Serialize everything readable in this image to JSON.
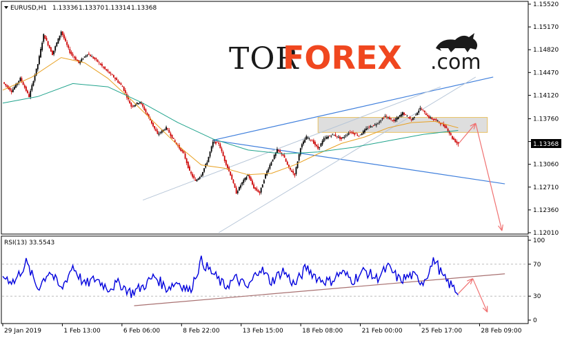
{
  "symbol_header": {
    "symbol": "EURUSD,H1",
    "open": "1.13336",
    "high": "1.13370",
    "low": "1.13314",
    "close": "1.13368"
  },
  "logo": {
    "part1": "TOR",
    "part2": "FOREX",
    "part3": ".com",
    "icon": "bull-icon"
  },
  "price_badge": "1.13368",
  "colors": {
    "candle_up": "#000000",
    "candle_down": "#cc0000",
    "ma_fast": "#e8a020",
    "ma_slow": "#1fa38c",
    "trend_blue": "#3f7fdc",
    "channel_grey": "#b7c6d8",
    "arrow": "#f07070",
    "zone_fill": "#d6d6d6",
    "zone_border": "#e8c060",
    "rsi_line": "#0000dd",
    "rsi_trend": "#a87070"
  },
  "chart_data": [
    {
      "type": "candlestick",
      "symbol": "EURUSD",
      "timeframe": "H1",
      "x_labels": [
        "29 Jan 2019",
        "1 Feb 13:00",
        "6 Feb 06:00",
        "8 Feb 22:00",
        "13 Feb 15:00",
        "18 Feb 08:00",
        "21 Feb 00:00",
        "25 Feb 17:00",
        "28 Feb 09:00"
      ],
      "y_ticks": [
        "1.15520",
        "1.15170",
        "1.14820",
        "1.14470",
        "1.14120",
        "1.13760",
        "1.13410",
        "1.13060",
        "1.12710",
        "1.12360",
        "1.12010"
      ],
      "y_tick_values": [
        1.1552,
        1.1517,
        1.1482,
        1.1447,
        1.1412,
        1.1376,
        1.1341,
        1.1306,
        1.1271,
        1.1236,
        1.1201
      ],
      "ylim": [
        1.1201,
        1.1552
      ],
      "last_price": 1.13368,
      "price_path": [
        {
          "x": 0,
          "y": 1.1432
        },
        {
          "x": 3,
          "y": 1.1418
        },
        {
          "x": 6,
          "y": 1.1438
        },
        {
          "x": 9,
          "y": 1.141
        },
        {
          "x": 12,
          "y": 1.146
        },
        {
          "x": 14,
          "y": 1.1505
        },
        {
          "x": 17,
          "y": 1.1475
        },
        {
          "x": 20,
          "y": 1.151
        },
        {
          "x": 23,
          "y": 1.1478
        },
        {
          "x": 26,
          "y": 1.1462
        },
        {
          "x": 29,
          "y": 1.1476
        },
        {
          "x": 32,
          "y": 1.1466
        },
        {
          "x": 35,
          "y": 1.1452
        },
        {
          "x": 38,
          "y": 1.144
        },
        {
          "x": 41,
          "y": 1.1425
        },
        {
          "x": 44,
          "y": 1.1395
        },
        {
          "x": 47,
          "y": 1.1402
        },
        {
          "x": 50,
          "y": 1.1378
        },
        {
          "x": 53,
          "y": 1.1352
        },
        {
          "x": 56,
          "y": 1.1362
        },
        {
          "x": 59,
          "y": 1.134
        },
        {
          "x": 62,
          "y": 1.1322
        },
        {
          "x": 64,
          "y": 1.1295
        },
        {
          "x": 66,
          "y": 1.128
        },
        {
          "x": 68,
          "y": 1.129
        },
        {
          "x": 70,
          "y": 1.131
        },
        {
          "x": 72,
          "y": 1.134
        },
        {
          "x": 74,
          "y": 1.1338
        },
        {
          "x": 76,
          "y": 1.1312
        },
        {
          "x": 78,
          "y": 1.129
        },
        {
          "x": 80,
          "y": 1.1262
        },
        {
          "x": 82,
          "y": 1.1278
        },
        {
          "x": 84,
          "y": 1.129
        },
        {
          "x": 86,
          "y": 1.127
        },
        {
          "x": 88,
          "y": 1.1262
        },
        {
          "x": 90,
          "y": 1.129
        },
        {
          "x": 92,
          "y": 1.131
        },
        {
          "x": 94,
          "y": 1.1328
        },
        {
          "x": 96,
          "y": 1.132
        },
        {
          "x": 98,
          "y": 1.13
        },
        {
          "x": 100,
          "y": 1.129
        },
        {
          "x": 102,
          "y": 1.1332
        },
        {
          "x": 104,
          "y": 1.1348
        },
        {
          "x": 106,
          "y": 1.1342
        },
        {
          "x": 108,
          "y": 1.133
        },
        {
          "x": 110,
          "y": 1.1345
        },
        {
          "x": 113,
          "y": 1.1352
        },
        {
          "x": 116,
          "y": 1.1345
        },
        {
          "x": 119,
          "y": 1.1356
        },
        {
          "x": 122,
          "y": 1.135
        },
        {
          "x": 125,
          "y": 1.1362
        },
        {
          "x": 128,
          "y": 1.1368
        },
        {
          "x": 131,
          "y": 1.138
        },
        {
          "x": 134,
          "y": 1.1372
        },
        {
          "x": 137,
          "y": 1.1385
        },
        {
          "x": 140,
          "y": 1.1374
        },
        {
          "x": 143,
          "y": 1.1392
        },
        {
          "x": 146,
          "y": 1.1378
        },
        {
          "x": 149,
          "y": 1.1372
        },
        {
          "x": 152,
          "y": 1.1362
        },
        {
          "x": 154,
          "y": 1.1346
        },
        {
          "x": 156,
          "y": 1.1337
        }
      ],
      "ma_fast_path": [
        {
          "x": 0,
          "y": 1.142
        },
        {
          "x": 10,
          "y": 1.144
        },
        {
          "x": 20,
          "y": 1.147
        },
        {
          "x": 28,
          "y": 1.1462
        },
        {
          "x": 36,
          "y": 1.1438
        },
        {
          "x": 44,
          "y": 1.1405
        },
        {
          "x": 52,
          "y": 1.137
        },
        {
          "x": 60,
          "y": 1.1335
        },
        {
          "x": 68,
          "y": 1.1305
        },
        {
          "x": 76,
          "y": 1.13
        },
        {
          "x": 84,
          "y": 1.129
        },
        {
          "x": 92,
          "y": 1.1292
        },
        {
          "x": 100,
          "y": 1.1305
        },
        {
          "x": 108,
          "y": 1.1322
        },
        {
          "x": 116,
          "y": 1.1338
        },
        {
          "x": 124,
          "y": 1.1348
        },
        {
          "x": 132,
          "y": 1.1362
        },
        {
          "x": 140,
          "y": 1.137
        },
        {
          "x": 148,
          "y": 1.1372
        },
        {
          "x": 156,
          "y": 1.1362
        }
      ],
      "ma_slow_path": [
        {
          "x": 0,
          "y": 1.14
        },
        {
          "x": 12,
          "y": 1.141
        },
        {
          "x": 24,
          "y": 1.143
        },
        {
          "x": 36,
          "y": 1.1425
        },
        {
          "x": 48,
          "y": 1.14
        },
        {
          "x": 60,
          "y": 1.137
        },
        {
          "x": 72,
          "y": 1.1345
        },
        {
          "x": 84,
          "y": 1.1328
        },
        {
          "x": 96,
          "y": 1.1322
        },
        {
          "x": 108,
          "y": 1.1325
        },
        {
          "x": 120,
          "y": 1.1332
        },
        {
          "x": 132,
          "y": 1.1342
        },
        {
          "x": 144,
          "y": 1.1352
        },
        {
          "x": 156,
          "y": 1.1358
        }
      ],
      "resistance_zone": {
        "x0": 108,
        "x1": 166,
        "y_low": 1.1355,
        "y_high": 1.1378
      },
      "trend_lines": [
        {
          "style": "blue",
          "from": {
            "x": 72,
            "y": 1.1343
          },
          "to": {
            "x": 172,
            "y": 1.1276
          }
        },
        {
          "style": "blue",
          "from": {
            "x": 72,
            "y": 1.1343
          },
          "to": {
            "x": 168,
            "y": 1.144
          }
        },
        {
          "style": "grey",
          "from": {
            "x": 48,
            "y": 1.1251
          },
          "to": {
            "x": 150,
            "y": 1.1425
          }
        },
        {
          "style": "grey",
          "from": {
            "x": 74,
            "y": 1.1201
          },
          "to": {
            "x": 162,
            "y": 1.144
          }
        }
      ],
      "forecast_arrows": [
        {
          "from": {
            "x": 156,
            "y": 1.1337
          },
          "to": {
            "x": 162,
            "y": 1.1369
          }
        },
        {
          "from": {
            "x": 162,
            "y": 1.1369
          },
          "to": {
            "x": 171,
            "y": 1.1204
          }
        }
      ]
    },
    {
      "type": "line",
      "title": "RSI(13) 33.5543",
      "y_ticks": [
        "100",
        "70",
        "30",
        "0"
      ],
      "y_tick_values": [
        100,
        70,
        30,
        0
      ],
      "ylim": [
        0,
        100
      ],
      "last_value": 33.5543,
      "rsi_path": [
        {
          "x": 0,
          "y": 55
        },
        {
          "x": 4,
          "y": 48
        },
        {
          "x": 8,
          "y": 72
        },
        {
          "x": 12,
          "y": 40
        },
        {
          "x": 16,
          "y": 62
        },
        {
          "x": 20,
          "y": 38
        },
        {
          "x": 24,
          "y": 68
        },
        {
          "x": 28,
          "y": 44
        },
        {
          "x": 32,
          "y": 52
        },
        {
          "x": 36,
          "y": 40
        },
        {
          "x": 40,
          "y": 46
        },
        {
          "x": 44,
          "y": 34
        },
        {
          "x": 48,
          "y": 42
        },
        {
          "x": 52,
          "y": 55
        },
        {
          "x": 56,
          "y": 40
        },
        {
          "x": 60,
          "y": 48
        },
        {
          "x": 64,
          "y": 36
        },
        {
          "x": 68,
          "y": 74
        },
        {
          "x": 72,
          "y": 58
        },
        {
          "x": 76,
          "y": 42
        },
        {
          "x": 80,
          "y": 52
        },
        {
          "x": 84,
          "y": 40
        },
        {
          "x": 88,
          "y": 66
        },
        {
          "x": 92,
          "y": 48
        },
        {
          "x": 96,
          "y": 62
        },
        {
          "x": 100,
          "y": 44
        },
        {
          "x": 104,
          "y": 66
        },
        {
          "x": 108,
          "y": 52
        },
        {
          "x": 112,
          "y": 48
        },
        {
          "x": 116,
          "y": 60
        },
        {
          "x": 120,
          "y": 50
        },
        {
          "x": 124,
          "y": 62
        },
        {
          "x": 128,
          "y": 52
        },
        {
          "x": 132,
          "y": 66
        },
        {
          "x": 136,
          "y": 50
        },
        {
          "x": 140,
          "y": 56
        },
        {
          "x": 144,
          "y": 48
        },
        {
          "x": 148,
          "y": 76
        },
        {
          "x": 151,
          "y": 52
        },
        {
          "x": 154,
          "y": 42
        },
        {
          "x": 156,
          "y": 34
        }
      ],
      "trend_line": {
        "from": {
          "x": 45,
          "y": 18
        },
        "to": {
          "x": 172,
          "y": 58
        }
      },
      "forecast_arrows": [
        {
          "from": {
            "x": 156,
            "y": 33
          },
          "to": {
            "x": 161,
            "y": 52
          }
        },
        {
          "from": {
            "x": 161,
            "y": 52
          },
          "to": {
            "x": 166,
            "y": 10
          }
        }
      ]
    }
  ]
}
